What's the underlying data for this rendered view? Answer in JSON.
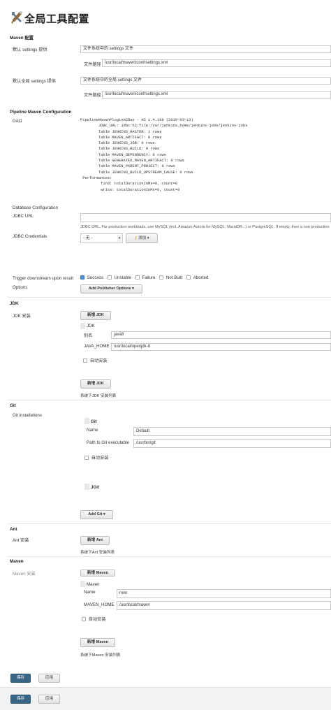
{
  "page": {
    "title": "全局工具配置"
  },
  "maven_config": {
    "heading": "Maven 配置",
    "default_settings_label": "默认 settings 提供",
    "default_settings_value": "文件系统中的 settings 文件",
    "default_path_label": "文件路径",
    "default_path_value": "/usr/local/maven/conf/settings.xml",
    "global_settings_label": "默认全局 settings 提供",
    "global_settings_value": "文件系统中的全局 settings 文件",
    "global_path_label": "文件路径",
    "global_path_value": "/usr/local/maven/conf/settings.xml"
  },
  "pipeline": {
    "heading": "Pipeline Maven Configuration",
    "dao_label": "DAO",
    "dao_lines": [
      "PipelineMavenPluginH2Dao - H2 1.4.199 (2019-03-13)",
      "        JDBC URL: jdbc:h2:file:/var/jenkins_home/jenkins-jobs/jenkins-jobs",
      "        Table JENKINS_MASTER: 1 rows",
      "        Table MAVEN_ARTIFACT: 0 rows",
      "        Table JENKINS_JOB: 0 rows",
      "        Table JENKINS_BUILD: 0 rows",
      "        Table MAVEN_DEPENDENCY: 0 rows",
      "        Table GENERATED_MAVEN_ARTIFACT: 0 rows",
      "        Table MAVEN_PARENT_PROJECT: 0 rows",
      "        Table JENKINS_BUILD_UPSTREAM_CAUSE: 0 rows",
      " Performances:",
      "         find: totalDurationInMs=0, count=0",
      "         write: totalDurationInMs=0, count=0"
    ],
    "db_config_label": "Database Configuration",
    "jdbc_url_label": "JDBC URL",
    "jdbc_url_value": "",
    "jdbc_url_hint": "JDBC URL. For production workloads, use MySQL (incl. Amazon Aurora for MySQL, MariaDB...) or PostgreSQL. If empty, then a non production",
    "jdbc_cred_label": "JDBC Credentials",
    "jdbc_cred_value": "- 无 -",
    "add_label": "添加",
    "trigger_label": "Trigger downstream upon result",
    "triggers": [
      {
        "label": "Success",
        "checked": true
      },
      {
        "label": "Unstable",
        "checked": false
      },
      {
        "label": "Failure",
        "checked": false
      },
      {
        "label": "Not Built",
        "checked": false
      },
      {
        "label": "Aborted",
        "checked": false
      }
    ],
    "options_label": "Options",
    "add_publisher_options": "Add Publisher Options"
  },
  "jdk": {
    "heading": "JDK",
    "install_label": "JDK 安装",
    "add_jdk_top": "新增 JDK",
    "entry_title": "JDK",
    "alias_label": "别名",
    "alias_value": "java8",
    "java_home_label": "JAVA_HOME",
    "java_home_value": "/usr/local/openjdk-8",
    "auto_install": "自动安装",
    "add_jdk_bottom": "新增 JDK",
    "list_note": "系统下JDK 安装列表"
  },
  "git": {
    "heading": "Git",
    "install_label": "Git installations",
    "entry_title": "Git",
    "name_label": "Name",
    "name_value": "Default",
    "path_label": "Path to Git executable",
    "path_value": "/usr/bin/git",
    "auto_install": "自动安装",
    "jgit_title": "JGit",
    "add_git": "Add Git"
  },
  "ant": {
    "heading": "Ant",
    "install_label": "Ant 安装",
    "add_ant": "新增 Ant",
    "list_note": "系统下Ant 安装列表"
  },
  "maven": {
    "heading": "Maven",
    "install_label": "Maven 安装",
    "add_maven_top": "新增 Maven",
    "entry_title": "Maven",
    "name_label": "Name",
    "name_value": "mvn",
    "home_label": "MAVEN_HOME",
    "home_value": "/usr/local/maven",
    "auto_install": "自动安装",
    "add_maven_bottom": "新增 Maven",
    "list_note": "系统下Maven 安装列表"
  },
  "footer": {
    "save": "保存",
    "apply": "应用"
  },
  "footer2": {
    "save": "保存",
    "apply": "应用"
  }
}
